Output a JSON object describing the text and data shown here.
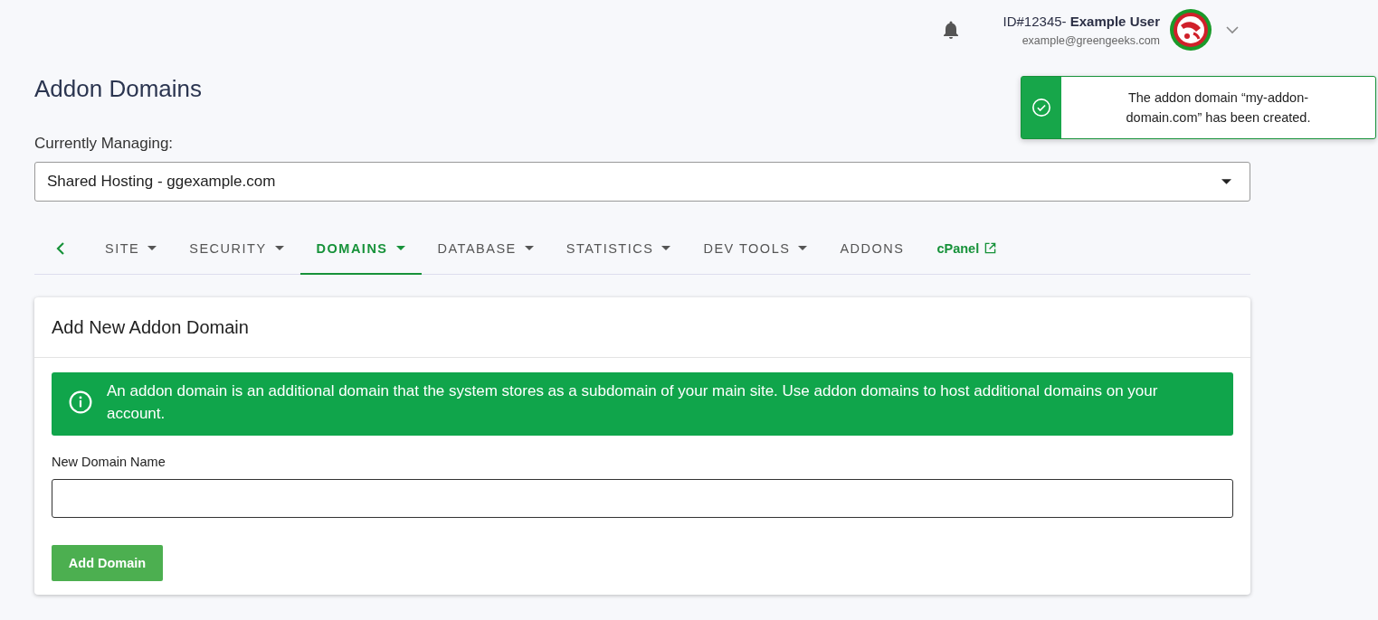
{
  "header": {
    "user_id": "ID#12345-",
    "user_name": "Example User",
    "email": "example@greengeeks.com"
  },
  "toast": {
    "message": "The addon domain “my-addon-domain.com” has been created."
  },
  "page_title": "Addon Domains",
  "managing": {
    "label": "Currently Managing:",
    "value": "Shared Hosting - ggexample.com"
  },
  "tabs": [
    {
      "label": "SITE",
      "kind": "menu",
      "selected": false
    },
    {
      "label": "SECURITY",
      "kind": "menu",
      "selected": false
    },
    {
      "label": "DOMAINS",
      "kind": "menu",
      "selected": true
    },
    {
      "label": "DATABASE",
      "kind": "menu",
      "selected": false
    },
    {
      "label": "STATISTICS",
      "kind": "menu",
      "selected": false
    },
    {
      "label": "DEV TOOLS",
      "kind": "menu",
      "selected": false
    },
    {
      "label": "ADDONS",
      "kind": "plain",
      "selected": false
    },
    {
      "label": "cPanel",
      "kind": "external",
      "selected": false
    }
  ],
  "card": {
    "title": "Add New Addon Domain",
    "info": "An addon domain is an additional domain that the system stores as a subdomain of your main site. Use addon domains to host additional domains on your account.",
    "field_label": "New Domain Name",
    "button": "Add Domain"
  }
}
